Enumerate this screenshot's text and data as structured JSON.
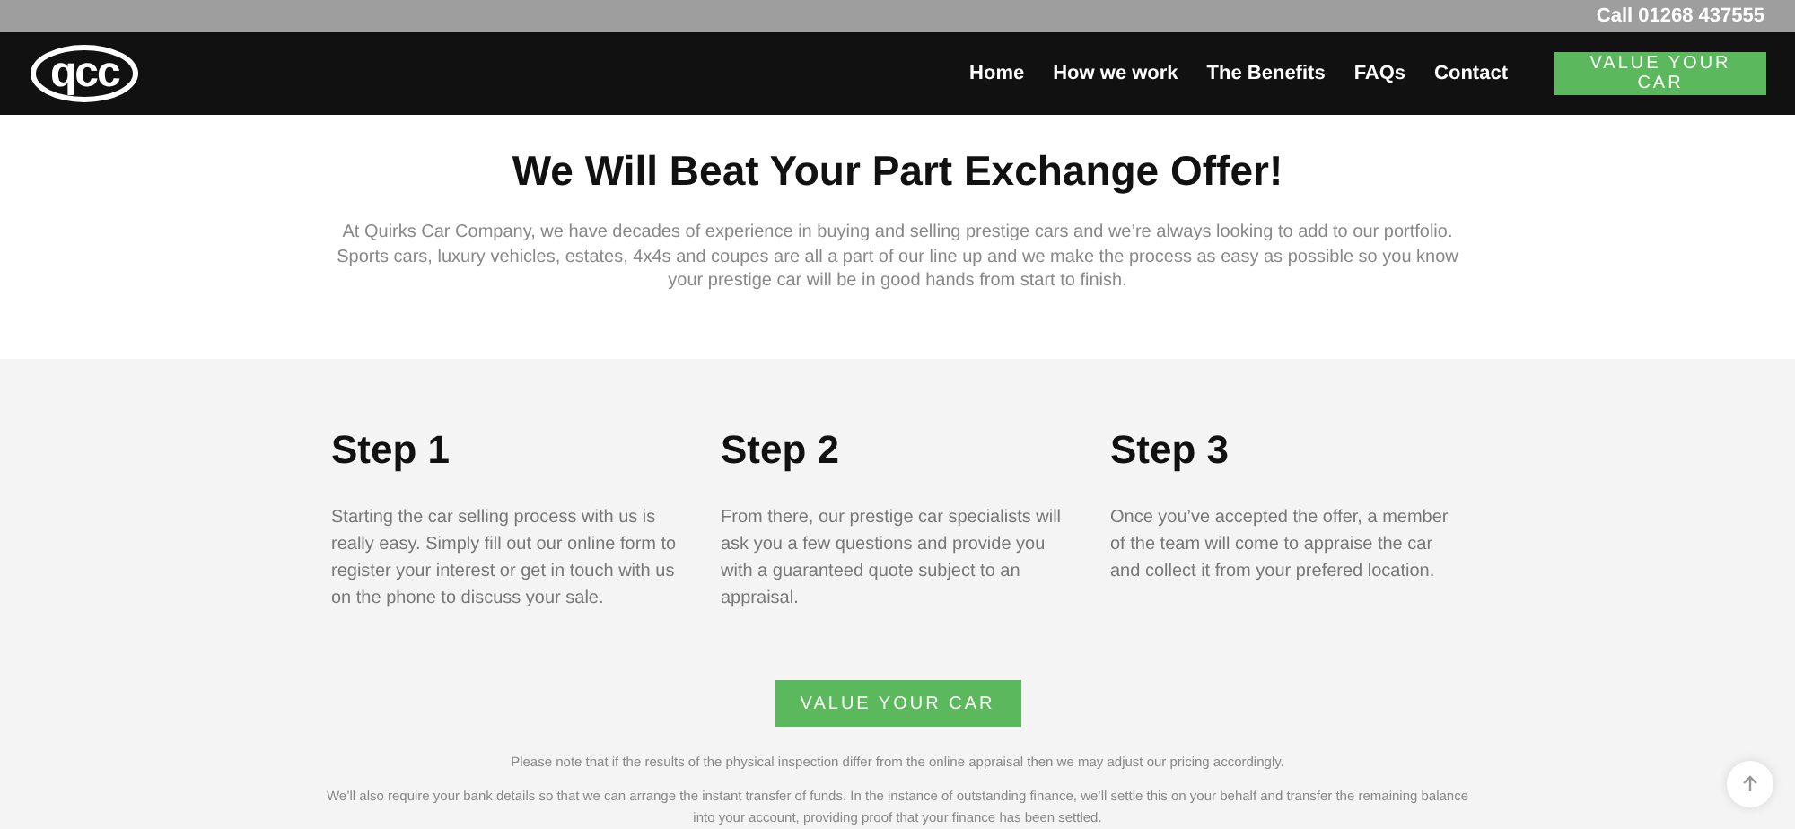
{
  "top_bar": {
    "phone": "Call 01268 437555"
  },
  "nav": {
    "logo": "qcc",
    "links": [
      "Home",
      "How we work",
      "The Benefits",
      "FAQs",
      "Contact"
    ],
    "cta": "VALUE YOUR CAR"
  },
  "intro": {
    "title": "We Will Beat Your Part Exchange Offer!",
    "text": "At Quirks Car Company, we have decades of experience in buying and selling prestige cars and we’re always looking to add to our portfolio. Sports cars, luxury vehicles, estates, 4x4s and coupes are all a part of our line up and we make the process as easy as possible so you know your prestige car will be in good hands from start to finish."
  },
  "steps": [
    {
      "title": "Step 1",
      "text": "Starting the car selling process with us is really easy. Simply fill out our online form to register your interest or get in touch with us on the phone to discuss your sale."
    },
    {
      "title": "Step 2",
      "text": "From there, our prestige car specialists will ask you a few questions and provide you with a guaranteed quote subject to an appraisal."
    },
    {
      "title": "Step 3",
      "text": "Once you’ve accepted the offer, a member of the team will come to appraise the car and collect it from your prefered location."
    }
  ],
  "cta_button": "VALUE YOUR CAR",
  "notes": [
    "Please note that if the results of the physical inspection differ from the online appraisal then we may adjust our pricing accordingly.",
    "We’ll also require your bank details so that we can arrange the instant transfer of funds. In the instance of outstanding finance, we’ll settle this on your behalf and transfer the remaining balance into your account, providing proof that your finance has been settled."
  ]
}
